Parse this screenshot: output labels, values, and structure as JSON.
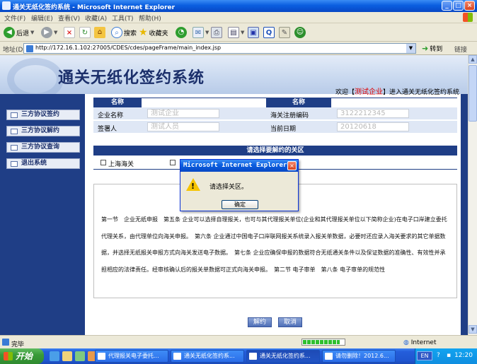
{
  "window": {
    "title": "通关无纸化签约系统 - Microsoft Internet Explorer",
    "min": "_",
    "max": "□",
    "close": "×"
  },
  "menu": [
    "文件(F)",
    "编辑(E)",
    "查看(V)",
    "收藏(A)",
    "工具(T)",
    "帮助(H)"
  ],
  "toolbar": {
    "back": "后退",
    "search": "搜索",
    "favorites": "收藏夹"
  },
  "address": {
    "label": "地址(D)",
    "url": "http://172.16.1.102:27005/CDES/cdes/pageFrame/main_index.jsp",
    "go": "转到",
    "links": "链接"
  },
  "header": {
    "logo": "通关无纸化签约系统",
    "welcome_prefix": "欢迎【",
    "company": "测试企业",
    "welcome_suffix": "】进入通关无纸化签约系统"
  },
  "nav": [
    {
      "label": "三方协议签约"
    },
    {
      "label": "三方协议解约"
    },
    {
      "label": "三方协议查询"
    },
    {
      "label": "退出系统"
    }
  ],
  "info": {
    "col_header_left": "名称",
    "col_header_right": "名称",
    "company_label": "企业名称",
    "company_value": "测试企业",
    "customs_code_label": "海关注册编码",
    "customs_code_value": "3122212345",
    "signer_label": "签署人",
    "signer_value": "测试人员",
    "date_label": "当前日期",
    "date_value": "20120618"
  },
  "customs": {
    "header": "请选择要解约的关区",
    "option": "上海海关"
  },
  "agreement": {
    "text": "第一节　企业无纸申报　第五条 企业可以选择自理报关，也可与其代理报关单位(企业和其代理报关单位以下简称企业)在电子口岸建立委托代理关系，由代理单位向海关申报。　第六条 企业通过中国电子口岸联网报关系统录入报关单数据，必要时还应录入海关要求的其它单据数据，并选择无纸报关申报方式向海关发送电子数据。　第七条 企业应确保申报的数据符合无纸通关条件以及保证数据的准确性、有效性并承担相应的法律责任。经审核确认后的报关单数据可正式向海关申报。　第二节 电子审单　第八条 电子审单的规范性"
  },
  "buttons": {
    "terminate": "解约",
    "cancel": "取消"
  },
  "dialog": {
    "title": "Microsoft Internet Explorer",
    "message": "请选择关区。",
    "ok": "确定",
    "close": "×"
  },
  "status": {
    "text": "完毕",
    "zone": "Internet",
    "progress": 0.9
  },
  "taskbar": {
    "start": "开始",
    "tasks": [
      {
        "label": "代理报关电子委托..."
      },
      {
        "label": "通关无纸化签约系..."
      },
      {
        "label": "通关无纸化签约系..."
      },
      {
        "label": "请勿删除！2012.6..."
      }
    ],
    "lang": "EN",
    "clock": "12:20"
  },
  "colors": {
    "nav_blue": "#1f3e86",
    "accent_red": "#e00000",
    "xp_blue": "#0a5ee0"
  }
}
